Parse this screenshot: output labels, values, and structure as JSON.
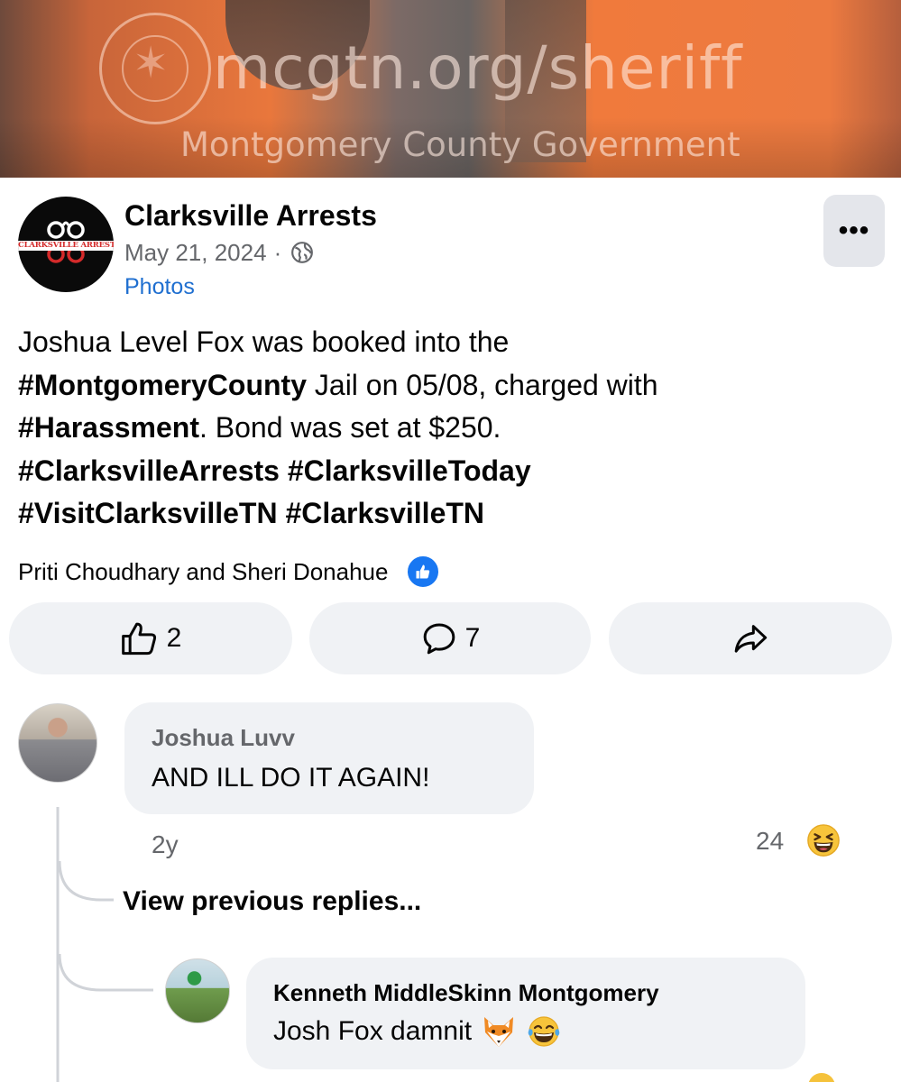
{
  "photo": {
    "watermark_url": "mcgtn.org/sheriff",
    "watermark_org": "Montgomery County Government"
  },
  "post": {
    "page_name": "Clarksville Arrests",
    "avatar_text": "CLARKSVILLE ARRESTS",
    "date": "May 21, 2024",
    "separator": "·",
    "link": "Photos",
    "more_label": "•••",
    "body": {
      "l1": "Joshua Level Fox was booked into the",
      "l2_tag": "#MontgomeryCounty",
      "l2_rest": " Jail on 05/08, charged with",
      "l3_tag": "#Harassment",
      "l3_rest": ". Bond was set at $250.",
      "l4": "#ClarksvilleArrests #ClarksvilleToday",
      "l5": "#VisitClarksvilleTN #ClarksvilleTN"
    },
    "reactors": "Priti Choudhary and Sheri Donahue",
    "like_count": "2",
    "comment_count": "7"
  },
  "comments": {
    "c1": {
      "author": "Joshua Luvv",
      "text": "AND ILL DO IT AGAIN!",
      "time": "2y",
      "reaction_count": "24"
    },
    "view_previous": "View previous replies...",
    "c2": {
      "author": "Kenneth MiddleSkinn Montgomery",
      "text": "Josh Fox  damnit"
    }
  },
  "colors": {
    "accent_blue": "#1877f2",
    "link_blue": "#1f6fd0",
    "muted_text": "#65676b",
    "bubble_bg": "#f0f2f5",
    "button_bg": "#f0f2f5"
  },
  "icons": {
    "globe": "globe-icon",
    "thumbs_up": "thumbs-up-icon",
    "comment": "comment-icon",
    "share": "share-icon",
    "like_badge": "like-badge-icon",
    "laugh_emoji": "grinning-squinting-emoji-icon",
    "fox_emoji": "fox-emoji-icon",
    "tears_emoji": "tears-of-joy-emoji-icon"
  }
}
